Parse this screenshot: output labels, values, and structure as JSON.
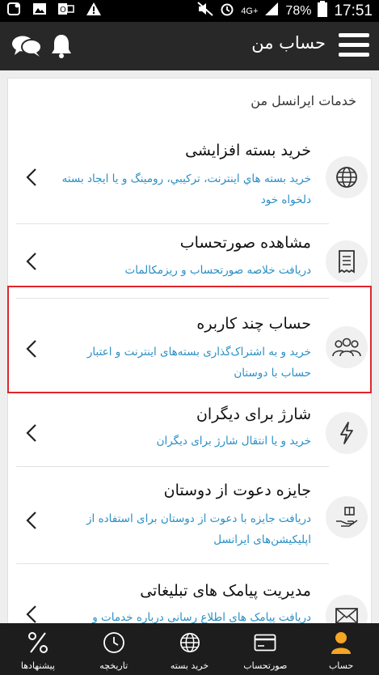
{
  "status_bar": {
    "network": "4G+",
    "battery": "78%",
    "time": "17:51"
  },
  "header": {
    "title": "حساب من",
    "icons": [
      "menu-icon",
      "bell-icon",
      "chat-icon"
    ]
  },
  "section": {
    "title": "خدمات ایرانسل من"
  },
  "items": [
    {
      "title": "خرید بسته افزایشی",
      "desc": "خرید بسته هاي اینترنت، ترکیبي، رومینگ و یا ایجاد بسته دلخواه خود",
      "icon": "globe-icon"
    },
    {
      "title": "مشاهده صورتحساب",
      "desc": "دریافت خلاصه صورتحساب و ریزمکالمات",
      "icon": "invoice-icon"
    },
    {
      "title": "حساب چند کاربره",
      "desc": "خرید و به اشتراک‌گذاری بسته‌های اینترنت و اعتبار حساب با دوستان",
      "icon": "group-icon"
    },
    {
      "title": "شارژ برای دیگران",
      "desc": "خرید و یا انتقال شارژ برای دیگران",
      "icon": "lightning-icon"
    },
    {
      "title": "جایزه دعوت از دوستان",
      "desc": "دریافت جایزه با دعوت از دوستان برای استفاده از اپلیکیشن‌های ایرانسل",
      "icon": "gift-hand-icon"
    },
    {
      "title": "مدیریت پیامک های تبلیغاتی",
      "desc": "دریافت پیامک های اطلاع رسانی درباره خدمات و",
      "icon": "mail-icon"
    }
  ],
  "bottom_nav": [
    {
      "label": "حساب",
      "icon": "user-icon",
      "active": true
    },
    {
      "label": "صورتحساب",
      "icon": "card-icon",
      "active": false
    },
    {
      "label": "خرید بسته",
      "icon": "globe-icon",
      "active": false
    },
    {
      "label": "تاریخچه",
      "icon": "clock-icon",
      "active": false
    },
    {
      "label": "پیشنهادها",
      "icon": "percent-icon",
      "active": false
    }
  ],
  "colors": {
    "accent": "#f5a623",
    "link": "#2a8fc4",
    "highlight": "#e0262b",
    "appbar": "#282828",
    "nav": "#1d1d1d"
  }
}
